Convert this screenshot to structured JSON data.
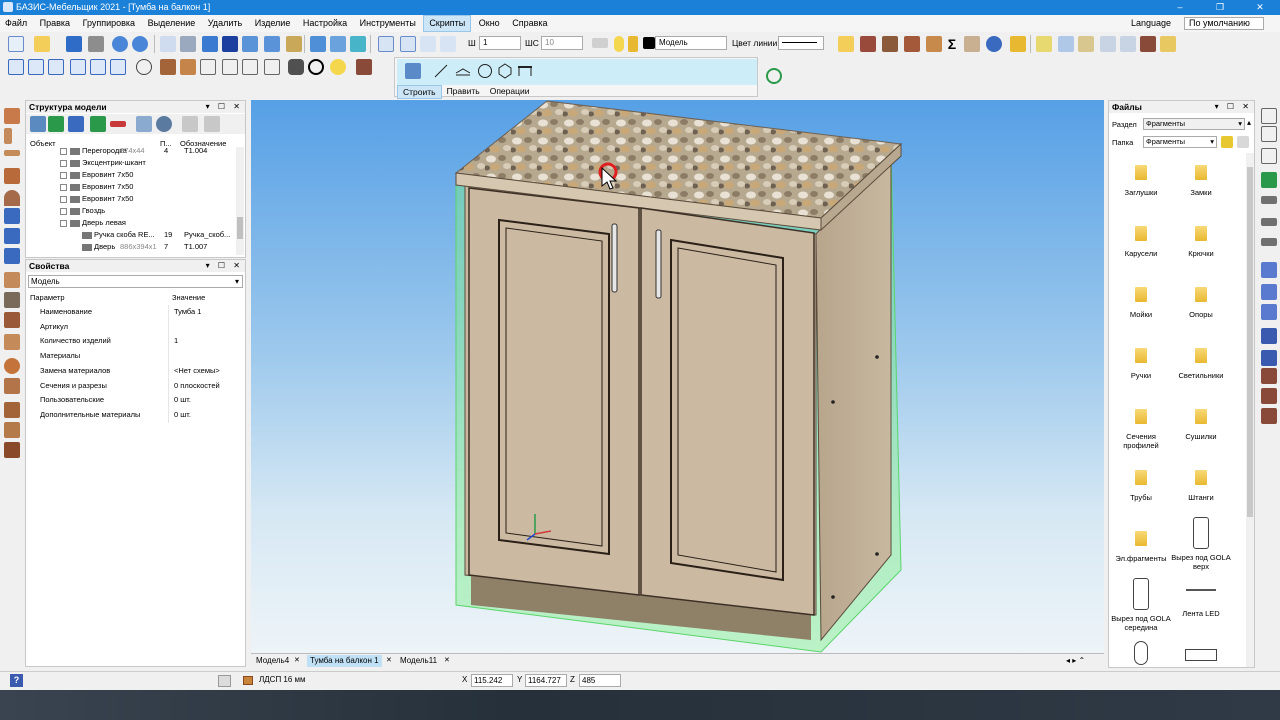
{
  "app": {
    "title": "БАЗИС-Мебельщик 2021 - [Тумба на балкон 1]",
    "win_minimize": "–",
    "win_restore": "❐",
    "win_close": "✕"
  },
  "menu": {
    "items": [
      "Файл",
      "Правка",
      "Группировка",
      "Выделение",
      "Удалить",
      "Изделие",
      "Настройка",
      "Инструменты",
      "Скрипты",
      "Окно",
      "Справка"
    ],
    "active": "Скрипты",
    "language_label": "Language",
    "language_value": "По умолчанию"
  },
  "toolbar": {
    "w_label": "Ш",
    "w_value": "1",
    "ws_label": "ШС",
    "ws_value": "10",
    "layer_value": "Модель",
    "line_color_label": "Цвет линии"
  },
  "subpanel": {
    "tabs": [
      "Строить",
      "Править",
      "Операции"
    ],
    "active_tab": "Строить"
  },
  "structure": {
    "title": "Структура модели",
    "col_object": "Объект",
    "col_p": "П...",
    "col_designation": "Обозначение",
    "rows": [
      {
        "name": "Перегородка",
        "extra": "874x44",
        "qty": "4",
        "des": "Т1.004"
      },
      {
        "name": "Эксцентрик-шкант",
        "extra": "",
        "qty": "",
        "des": ""
      },
      {
        "name": "Евровинт 7x50",
        "extra": "",
        "qty": "",
        "des": ""
      },
      {
        "name": "Евровинт 7x50",
        "extra": "",
        "qty": "",
        "des": ""
      },
      {
        "name": "Евровинт 7x50",
        "extra": "",
        "qty": "",
        "des": ""
      },
      {
        "name": "Гвоздь",
        "extra": "",
        "qty": "",
        "des": ""
      },
      {
        "name": "Дверь левая",
        "extra": "",
        "qty": "",
        "des": ""
      },
      {
        "name": "Ручка скоба RE...",
        "extra": "",
        "qty": "19",
        "des": "Ручка_скоб..."
      },
      {
        "name": "Дверь",
        "extra": "886x394x1",
        "qty": "7",
        "des": "Т1.007"
      }
    ]
  },
  "properties": {
    "title": "Свойства",
    "selector": "Модель",
    "col_param": "Параметр",
    "col_value": "Значение",
    "rows": [
      {
        "k": "Наименование",
        "v": "Тумба 1"
      },
      {
        "k": "Артикул",
        "v": ""
      },
      {
        "k": "Количество изделий",
        "v": "1"
      },
      {
        "k": "Материалы",
        "v": ""
      },
      {
        "k": "Замена материалов",
        "v": "<Нет схемы>"
      },
      {
        "k": "Сечения и разрезы",
        "v": "0 плоскостей"
      },
      {
        "k": "Пользовательские",
        "v": "0 шт."
      },
      {
        "k": "Дополнительные материалы",
        "v": "0 шт."
      }
    ]
  },
  "files": {
    "title": "Файлы",
    "section_label": "Раздел",
    "section_value": "Фрагменты",
    "folder_label": "Папка",
    "folder_value": "Фрагменты",
    "items": [
      "Заглушки",
      "Замки",
      "Карусели",
      "Крючки",
      "Мойки",
      "Опоры",
      "Ручки",
      "Светильники",
      "Сечения профилей",
      "Сушилки",
      "Трубы",
      "Штанги",
      "Эл.фрагменты",
      "Вырез под GOLA верх",
      "Вырез под GOLA середина",
      "Лента LED"
    ]
  },
  "doc_tabs": {
    "items": [
      "Модель4",
      "Тумба на балкон 1",
      "Модель11"
    ],
    "active": "Тумба на балкон 1",
    "close": "✕"
  },
  "status": {
    "material": "ЛДСП 16 мм",
    "x_label": "X",
    "x_value": "115.242",
    "y_label": "Y",
    "y_value": "1164.727",
    "z_label": "Z",
    "z_value": "485",
    "help": "?"
  },
  "colors": {
    "accent": "#1a80d8",
    "carcass": "#c9b79f",
    "selection": "#7ef08a"
  }
}
